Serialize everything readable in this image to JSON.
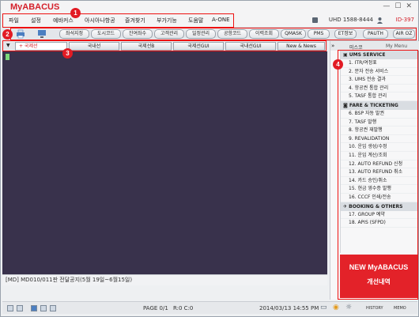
{
  "app": {
    "title": "MyABACUS"
  },
  "window_controls": {
    "minimize": "—",
    "restore": "☐",
    "close": "✕"
  },
  "menu": {
    "items": [
      "파일",
      "설정",
      "예바커스",
      "아시아나항공",
      "즐겨찾기",
      "부가기능",
      "도움말",
      "A-ONE"
    ]
  },
  "header": {
    "hotline": "UHD 1588-8444",
    "user_id": "ID-397"
  },
  "toolbar": {
    "buttons": [
      "좌석지정",
      "도시코드",
      "잔여좌수",
      "고객관리",
      "일정관리",
      "공항코드",
      "이력조회",
      "QMASK",
      "PMS",
      "ET정보",
      "PAUTH",
      "AIR OZ"
    ]
  },
  "terminal_tabs": {
    "active": "+ 국제선",
    "tabs": [
      "국내선",
      "국제선B",
      "국제선GUI",
      "국내선GUI",
      "New & News"
    ]
  },
  "status": {
    "message": "[MD] MD010/011판 전달공지(5월 19일~6월15일)",
    "page": "PAGE 0/1",
    "rc": "R:0 C:0",
    "datetime": "2014/03/13 14:55 PM",
    "history": "HISTORY",
    "memo": "MEMO"
  },
  "right_panel": {
    "tab_left": "미스코",
    "tab_right": "My Menu",
    "sections": [
      {
        "title": "UMS SERVICE",
        "items": [
          "1. ITR/여정표",
          "2. 문자 전송 서비스",
          "3. UMS 전송 결과",
          "4. 항공권 통합 관리",
          "5. TASF 통합 관리"
        ]
      },
      {
        "title": "FARE & TICKETING",
        "items": [
          "6. BSP 자동 발권",
          "7. TASF 발행",
          "8. 항공권 재발행",
          "9. REVALIDATION",
          "10. 운임 생성/수정",
          "11. 운임 계산/조회",
          "12. AUTO REFUND 신청",
          "13. AUTO REFUND 취소",
          "14. 카드 승인/취소",
          "15. 현금 영수증 발행",
          "16. CCCF 인쇄/전송"
        ]
      },
      {
        "title": "BOOKING & OTHERS",
        "items": [
          "17. GROUP 예약",
          "18. APIS (SFPD)"
        ]
      }
    ],
    "promo_line1": "NEW MyABACUS",
    "promo_line2": "개선내역"
  },
  "callouts": [
    "1",
    "2",
    "3",
    "4"
  ],
  "colors": {
    "brand_red": "#d4202a",
    "terminal_bg": "#39324c",
    "promo_bg": "#e32229"
  }
}
